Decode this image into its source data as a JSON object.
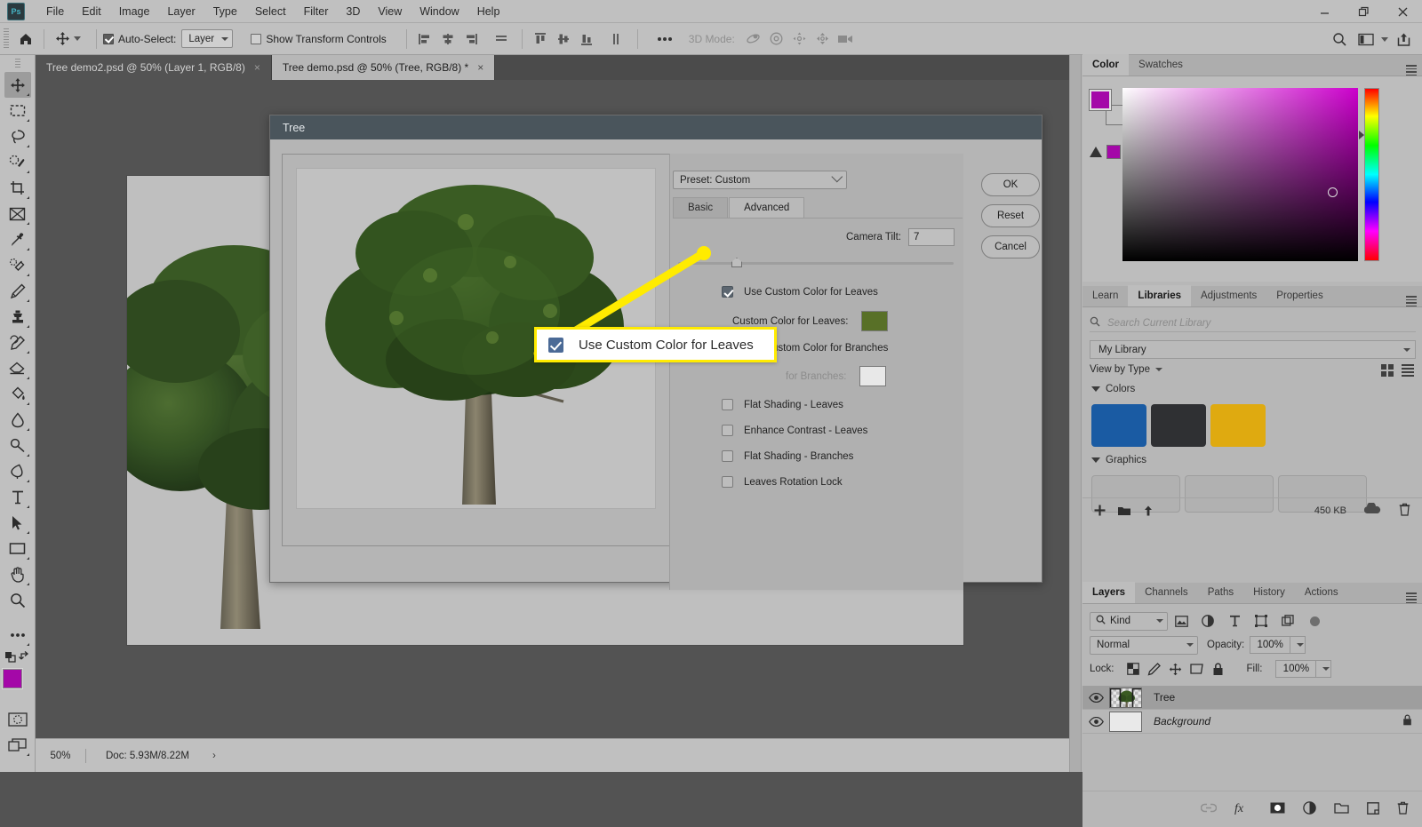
{
  "app": {
    "name": "Adobe Photoshop",
    "logo_text": "Ps"
  },
  "menubar": {
    "items": [
      "File",
      "Edit",
      "Image",
      "Layer",
      "Type",
      "Select",
      "Filter",
      "3D",
      "View",
      "Window",
      "Help"
    ],
    "window_controls": [
      "minimize-icon",
      "restore-icon",
      "close-icon"
    ]
  },
  "options_bar": {
    "home_icon": "home-icon",
    "tool_icon": "move-tool-icon",
    "auto_select_label": "Auto-Select:",
    "auto_select_checked": true,
    "target_value": "Layer",
    "show_transform_label": "Show Transform Controls",
    "show_transform_checked": false,
    "align_icons": [
      "align-left-edges-icon",
      "align-horizontal-centers-icon",
      "align-right-edges-icon",
      "distribute-horizontal-icon"
    ],
    "align_icons_2": [
      "align-top-edges-icon",
      "align-vertical-centers-icon",
      "align-bottom-edges-icon",
      "distribute-vertical-icon"
    ],
    "more_icon": "ellipsis-icon",
    "mode_3d_label": "3D Mode:",
    "mode_3d_icons": [
      "orbit-3d-icon",
      "roll-3d-icon",
      "pan-3d-icon",
      "slide-3d-icon",
      "scale-3d-icon"
    ],
    "right_icons": [
      "search-icon",
      "workspace-icon",
      "chevron-down-icon",
      "share-icon"
    ]
  },
  "tabs": [
    {
      "label": "Tree demo2.psd @ 50% (Layer 1, RGB/8)",
      "active": false,
      "close": "×"
    },
    {
      "label": "Tree demo.psd @ 50% (Tree, RGB/8) *",
      "active": true,
      "close": "×"
    }
  ],
  "toolbar": {
    "tools": [
      {
        "name": "move-tool",
        "glyph": "move",
        "selected": true
      },
      {
        "name": "rectangular-marquee-tool",
        "glyph": "marquee",
        "selected": false
      },
      {
        "name": "lasso-tool",
        "glyph": "lasso",
        "selected": false
      },
      {
        "name": "object-selection-tool",
        "glyph": "quickselect",
        "selected": false
      },
      {
        "name": "crop-tool",
        "glyph": "crop",
        "selected": false
      },
      {
        "name": "frame-tool",
        "glyph": "frame",
        "selected": false
      },
      {
        "name": "eyedropper-tool",
        "glyph": "eyedropper",
        "selected": false
      },
      {
        "name": "spot-healing-brush-tool",
        "glyph": "healing",
        "selected": false
      },
      {
        "name": "brush-tool",
        "glyph": "brush",
        "selected": false
      },
      {
        "name": "clone-stamp-tool",
        "glyph": "stamp",
        "selected": false
      },
      {
        "name": "history-brush-tool",
        "glyph": "historybrush",
        "selected": false
      },
      {
        "name": "eraser-tool",
        "glyph": "eraser",
        "selected": false
      },
      {
        "name": "gradient-tool",
        "glyph": "paintbucket",
        "selected": false
      },
      {
        "name": "blur-tool",
        "glyph": "blur",
        "selected": false
      },
      {
        "name": "dodge-tool",
        "glyph": "dodge",
        "selected": false
      },
      {
        "name": "pen-tool",
        "glyph": "pen",
        "selected": false
      },
      {
        "name": "horizontal-type-tool",
        "glyph": "type",
        "selected": false
      },
      {
        "name": "path-selection-tool",
        "glyph": "pathselect",
        "selected": false
      },
      {
        "name": "rectangle-tool",
        "glyph": "rectangle",
        "selected": false
      },
      {
        "name": "hand-tool",
        "glyph": "hand",
        "selected": false
      },
      {
        "name": "zoom-tool",
        "glyph": "zoom",
        "selected": false
      },
      {
        "name": "edit-toolbar",
        "glyph": "ellipsis",
        "selected": false
      }
    ],
    "foreground_color": "#a408a8",
    "background_color": "#c9c9c9"
  },
  "status_bar": {
    "zoom": "50%",
    "doc": "Doc: 5.93M/8.22M",
    "arrow": "›"
  },
  "dialog": {
    "title": "Tree",
    "preset_label": "Preset: Custom",
    "tabs": [
      {
        "label": "Basic",
        "active": false
      },
      {
        "label": "Advanced",
        "active": true
      }
    ],
    "camera_tilt_label": "Camera Tilt:",
    "camera_tilt_value": "7",
    "options": [
      {
        "label": "Use Custom Color for Leaves",
        "checked": true,
        "dim": false
      },
      {
        "label": "Use Custom Color for Branches",
        "checked": false,
        "dim": false
      },
      {
        "label": "Flat Shading - Leaves",
        "checked": false,
        "dim": false
      },
      {
        "label": "Enhance Contrast - Leaves",
        "checked": false,
        "dim": false
      },
      {
        "label": "Flat Shading - Branches",
        "checked": false,
        "dim": false
      },
      {
        "label": "Leaves Rotation Lock",
        "checked": false,
        "dim": false
      }
    ],
    "leaves_color_label": "Custom Color for Leaves:",
    "leaves_color": "#587027",
    "branches_color_label": "for Branches:",
    "branches_color": "#e8e8e8",
    "buttons": [
      "OK",
      "Reset",
      "Cancel"
    ]
  },
  "callout": {
    "text": "Use Custom Color for Leaves",
    "checked": true,
    "highlight_color": "#ffeb00",
    "checkbox_color": "#4b6a96"
  },
  "right_panels": {
    "color_panel": {
      "tabs": [
        {
          "label": "Color",
          "active": true
        },
        {
          "label": "Swatches",
          "active": false
        }
      ],
      "foreground_color": "#a408a8",
      "background_color": "#c2c2c2",
      "out_of_gamut_swatch": "#a408a8"
    },
    "libraries_panel": {
      "tabs": [
        {
          "label": "Learn",
          "active": false
        },
        {
          "label": "Libraries",
          "active": true
        },
        {
          "label": "Adjustments",
          "active": false
        },
        {
          "label": "Properties",
          "active": false
        }
      ],
      "search_placeholder": "Search Current Library",
      "library_name": "My Library",
      "view_by_label": "View by Type",
      "colors_section": "Colors",
      "colors": [
        "#1a5ba3",
        "#2f3033",
        "#dfaa10"
      ],
      "graphics_section": "Graphics",
      "graphics_count": 3,
      "footer_size": "450 KB",
      "footer_icons": [
        "add-icon",
        "folder-icon",
        "upload-icon",
        "cloud-icon",
        "trash-icon"
      ]
    },
    "layers_panel": {
      "tabs": [
        {
          "label": "Layers",
          "active": true
        },
        {
          "label": "Channels",
          "active": false
        },
        {
          "label": "Paths",
          "active": false
        },
        {
          "label": "History",
          "active": false
        },
        {
          "label": "Actions",
          "active": false
        }
      ],
      "filter_kind": "Kind",
      "filter_icons": [
        "pixel-filter-icon",
        "adjustment-filter-icon",
        "type-filter-icon",
        "shape-filter-icon",
        "smart-object-filter-icon"
      ],
      "blend_mode": "Normal",
      "opacity_label": "Opacity:",
      "opacity_value": "100%",
      "lock_label": "Lock:",
      "lock_icons": [
        "lock-transparent-pixels-icon",
        "lock-image-pixels-icon",
        "lock-position-icon",
        "lock-artboard-icon",
        "lock-all-icon"
      ],
      "fill_label": "Fill:",
      "fill_value": "100%",
      "layers": [
        {
          "name": "Tree",
          "visible": true,
          "selected": true,
          "italic": false,
          "locked": false,
          "thumb": "tree-thumbnail"
        },
        {
          "name": "Background",
          "visible": true,
          "selected": false,
          "italic": true,
          "locked": true,
          "thumb": "background-thumbnail"
        }
      ],
      "footer_icons": [
        "link-layers-icon",
        "layer-style-fx-icon",
        "layer-mask-icon",
        "adjustment-layer-icon",
        "new-group-icon",
        "new-layer-icon",
        "delete-layer-icon"
      ]
    }
  }
}
